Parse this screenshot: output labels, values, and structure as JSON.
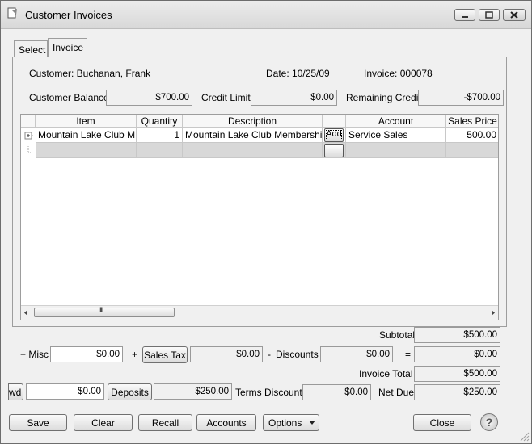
{
  "window": {
    "title": "Customer Invoices"
  },
  "tabs": [
    "Select",
    "Invoice"
  ],
  "header": {
    "customer": "Customer: Buchanan, Frank",
    "date": "Date: 10/25/09",
    "invoice": "Invoice: 000078"
  },
  "balances": {
    "customer_balance_label": "Customer Balance",
    "customer_balance": "$700.00",
    "credit_limit_label": "Credit Limit",
    "credit_limit": "$0.00",
    "remaining_credit_label": "Remaining Credit",
    "remaining_credit": "-$700.00"
  },
  "grid": {
    "columns": [
      "Item",
      "Quantity",
      "Description",
      "",
      "Account",
      "Sales Price"
    ],
    "rows": [
      {
        "item": "Mountain Lake Club M",
        "quantity": "1",
        "description": "Mountain Lake Club Membershi",
        "add_label": "Add",
        "account": "Service Sales",
        "price": "500.00"
      }
    ],
    "scroll_marker": "III"
  },
  "totals": {
    "subtotal_label": "Subtotal",
    "subtotal": "$500.00",
    "misc_label": "+ Misc",
    "misc": "$0.00",
    "plus_label": "+",
    "sales_tax_button": "Sales Tax",
    "sales_tax": "$0.00",
    "minus_label": "-",
    "discounts_label": "Discounts",
    "discounts": "$0.00",
    "equals_label": "=",
    "after_discount": "$0.00",
    "invoice_total_label": "Invoice Total",
    "invoice_total": "$500.00",
    "fwd_button": "wd",
    "fwd_value": "$0.00",
    "deposits_button": "Deposits",
    "deposits": "$250.00",
    "terms_discount_label": "Terms Discount",
    "terms_discount": "$0.00",
    "net_due_label": "Net Due",
    "net_due": "$250.00"
  },
  "footer": {
    "save": "Save",
    "clear": "Clear",
    "recall": "Recall",
    "accounts": "Accounts",
    "options": "Options",
    "close": "Close",
    "help": "?"
  }
}
